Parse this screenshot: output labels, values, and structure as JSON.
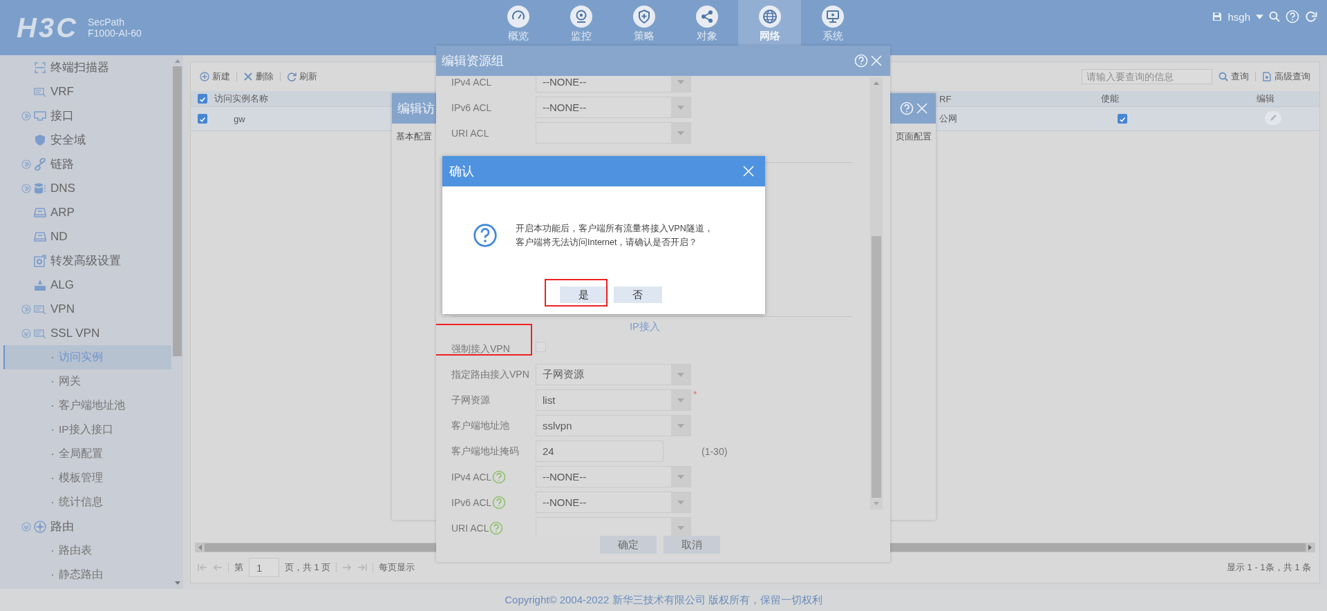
{
  "header": {
    "brand": "H3C",
    "product": "SecPath",
    "model": "F1000-AI-60",
    "user": "hsgh",
    "nav": [
      {
        "label": "概览",
        "selected": false
      },
      {
        "label": "监控",
        "selected": false
      },
      {
        "label": "策略",
        "selected": false
      },
      {
        "label": "对象",
        "selected": false
      },
      {
        "label": "网络",
        "selected": true
      },
      {
        "label": "系统",
        "selected": false
      }
    ]
  },
  "sidebar": {
    "items": [
      {
        "kind": "leaf",
        "label": "终端扫描器"
      },
      {
        "kind": "leaf",
        "label": "VRF"
      },
      {
        "kind": "group",
        "label": "接口",
        "expanded": false
      },
      {
        "kind": "leaf",
        "label": "安全域"
      },
      {
        "kind": "group",
        "label": "链路",
        "expanded": false
      },
      {
        "kind": "group",
        "label": "DNS",
        "expanded": false
      },
      {
        "kind": "leaf",
        "label": "ARP"
      },
      {
        "kind": "leaf",
        "label": "ND"
      },
      {
        "kind": "leaf",
        "label": "转发高级设置"
      },
      {
        "kind": "leaf",
        "label": "ALG"
      },
      {
        "kind": "group",
        "label": "VPN",
        "expanded": false
      },
      {
        "kind": "group",
        "label": "SSL VPN",
        "expanded": true,
        "children": [
          {
            "label": "访问实例",
            "selected": true
          },
          {
            "label": "网关",
            "selected": false
          },
          {
            "label": "客户端地址池",
            "selected": false
          },
          {
            "label": "IP接入接口",
            "selected": false
          },
          {
            "label": "全局配置",
            "selected": false
          },
          {
            "label": "模板管理",
            "selected": false
          },
          {
            "label": "统计信息",
            "selected": false
          }
        ]
      },
      {
        "kind": "group",
        "label": "路由",
        "expanded": true,
        "children": [
          {
            "label": "路由表",
            "selected": false
          },
          {
            "label": "静态路由",
            "selected": false
          }
        ]
      }
    ]
  },
  "toolbar": {
    "buttons": [
      "新建",
      "删除",
      "刷新"
    ],
    "search": {
      "placeholder": "请输入要查询的信息"
    },
    "query": "查询",
    "advanced": "高级查询"
  },
  "table": {
    "columns": [
      "访问实例名称",
      "RF",
      "使能",
      "编辑"
    ],
    "header_checked": true,
    "rows": [
      {
        "checked": true,
        "name": "gw",
        "vrf": "公网",
        "enabled": true
      }
    ]
  },
  "pagination": {
    "prefix": "第",
    "page": "1",
    "suffix": "页，共 1 页",
    "per_page": "每页显示",
    "summary": "显示 1 - 1条，共 1 条"
  },
  "dialog_back": {
    "title": "编辑访",
    "tabs": [
      "基本配置",
      "页面配置"
    ]
  },
  "dialog_resource_group": {
    "title": "编辑资源组",
    "top_rows": [
      {
        "kind": "select",
        "label": "IPv4 ACL",
        "value": "--NONE--"
      },
      {
        "kind": "select",
        "label": "IPv6 ACL",
        "value": "--NONE--"
      },
      {
        "kind": "select",
        "label": "URI ACL"
      }
    ],
    "section": "IP接入",
    "rows": [
      {
        "kind": "checkbox",
        "label": "强制接入VPN",
        "checked": false,
        "help": false,
        "annotated": true
      },
      {
        "kind": "select",
        "label": "指定路由接入VPN",
        "value": "子网资源",
        "help": false,
        "annotated": false
      },
      {
        "kind": "select",
        "label": "子网资源",
        "value": "list",
        "help": false,
        "required_mark": "*",
        "annotated": false
      },
      {
        "kind": "select",
        "label": "客户端地址池",
        "value": "sslvpn",
        "help": false,
        "annotated": false
      },
      {
        "kind": "text",
        "label": "客户端地址掩码",
        "value": "24",
        "hint": "(1-30)",
        "help": false,
        "annotated": false
      },
      {
        "kind": "select",
        "label": "IPv4 ACL",
        "value": "--NONE--",
        "help": true,
        "annotated": false
      },
      {
        "kind": "select",
        "label": "IPv6 ACL",
        "value": "--NONE--",
        "help": true,
        "annotated": false
      },
      {
        "kind": "select",
        "label": "URI ACL",
        "help": true,
        "annotated": false
      }
    ],
    "buttons": [
      "确定",
      "取消"
    ]
  },
  "confirm": {
    "title": "确认",
    "message": [
      "开启本功能后，客户端所有流量将接入VPN隧道，",
      "客户端将无法访问Internet，请确认是否开启？"
    ],
    "buttons": [
      {
        "label": "是",
        "annotated": true
      },
      {
        "label": "否",
        "annotated": false
      }
    ]
  },
  "footer": "Copyright© 2004-2022 新华三技术有限公司 版权所有，保留一切权利"
}
